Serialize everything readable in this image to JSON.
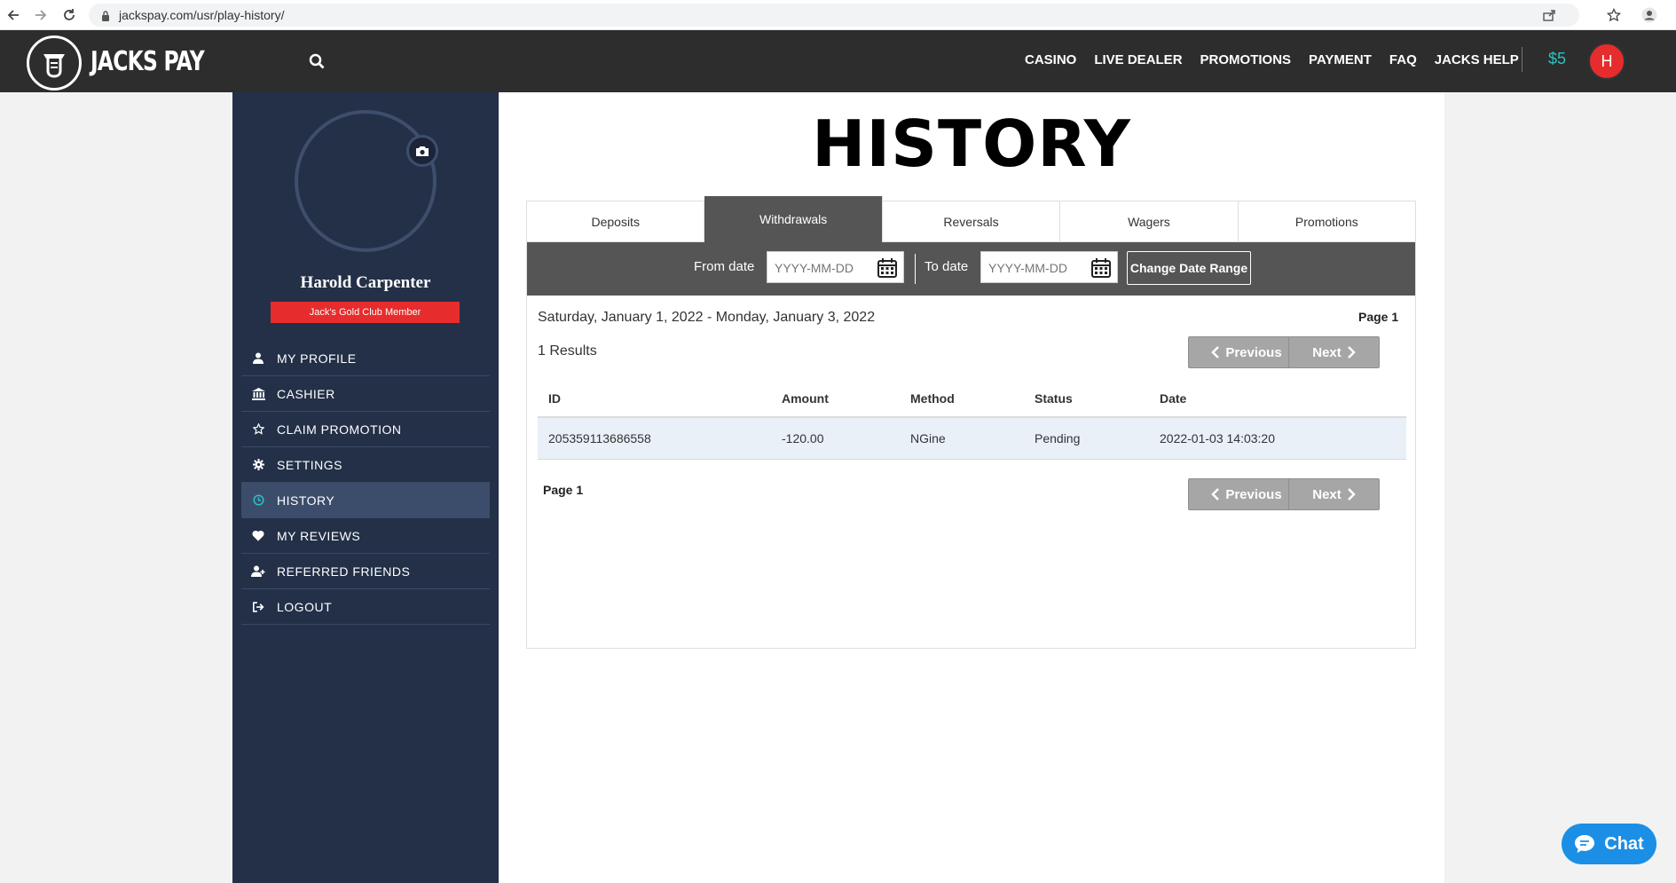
{
  "browser": {
    "url": "jackspay.com/usr/play-history/"
  },
  "header": {
    "brand": "JACKS PAY",
    "menu": [
      "CASINO",
      "LIVE DEALER",
      "PROMOTIONS",
      "PAYMENT",
      "FAQ",
      "JACKS HELP"
    ],
    "balance": "$5",
    "avatar_initial": "H"
  },
  "sidebar": {
    "user_name": "Harold Carpenter",
    "member_badge": "Jack's Gold Club Member",
    "items": [
      {
        "label": "MY PROFILE",
        "icon": "user-icon"
      },
      {
        "label": "CASHIER",
        "icon": "bank-icon"
      },
      {
        "label": "CLAIM PROMOTION",
        "icon": "star-icon"
      },
      {
        "label": "SETTINGS",
        "icon": "gear-icon"
      },
      {
        "label": "HISTORY",
        "icon": "clock-icon"
      },
      {
        "label": "MY REVIEWS",
        "icon": "heart-icon"
      },
      {
        "label": "REFERRED FRIENDS",
        "icon": "user-plus-icon"
      },
      {
        "label": "LOGOUT",
        "icon": "logout-icon"
      }
    ],
    "active_item": "HISTORY"
  },
  "main": {
    "title": "HISTORY",
    "tabs": [
      "Deposits",
      "Withdrawals",
      "Reversals",
      "Wagers",
      "Promotions"
    ],
    "active_tab": "Withdrawals",
    "filter": {
      "from_label": "From date",
      "from_placeholder": "YYYY-MM-DD",
      "to_label": "To date",
      "to_placeholder": "YYYY-MM-DD",
      "button": "Change Date Range"
    },
    "date_range": "Saturday, January 1, 2022 - Monday, January 3, 2022",
    "page_label": "Page 1",
    "results": "1 Results",
    "previous": "Previous",
    "next": "Next",
    "table": {
      "columns": [
        "ID",
        "Amount",
        "Method",
        "Status",
        "Date"
      ],
      "rows": [
        [
          "205359113686558",
          "-120.00",
          "NGine",
          "Pending",
          "2022-01-03 14:03:20"
        ]
      ]
    }
  },
  "chat": {
    "label": "Chat"
  }
}
